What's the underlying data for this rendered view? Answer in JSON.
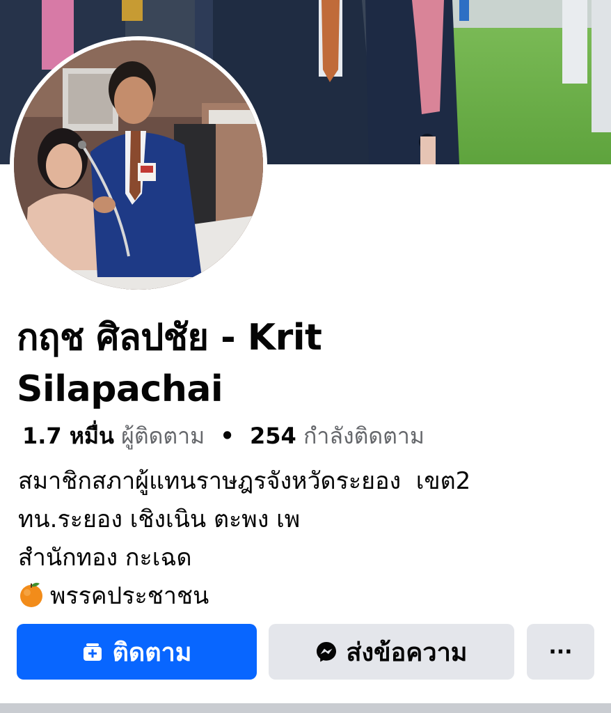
{
  "profile": {
    "name": "กฤช ศิลปชัย - Krit Silapachai",
    "followers_count": "1.7 หมื่น",
    "followers_label": "ผู้ติดตาม",
    "separator": "•",
    "following_count": "254",
    "following_label": "กำลังติดตาม"
  },
  "bio": {
    "line1": "สมาชิกสภาผู้แทนราษฎรจังหวัดระยอง  เขต2",
    "line2": "ทน.ระยอง เชิงเนิน ตะพง เพ",
    "line3": "สำนักทอง กะเฉด",
    "line4_emoji": "orange-emoji",
    "line4": "พรรคประชาชน"
  },
  "actions": {
    "follow_label": "ติดตาม",
    "follow_icon": "follow-page-icon",
    "message_label": "ส่งข้อความ",
    "message_icon": "messenger-icon",
    "more_label": "···"
  },
  "colors": {
    "primary": "#0866ff",
    "secondary_button": "#e4e6eb",
    "muted_text": "#65676b"
  }
}
